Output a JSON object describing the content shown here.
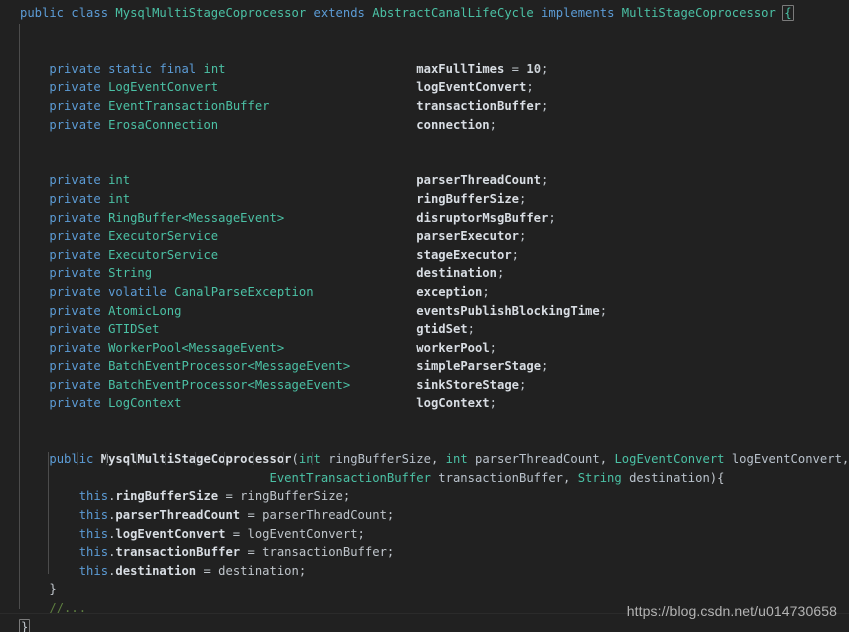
{
  "editor": {
    "language": "java",
    "background_color": "#212121",
    "theme": "dark",
    "colors": {
      "keyword": "#5c9cd6",
      "type": "#4bc1a5",
      "field": "#d8dde3",
      "comment": "#5f8040",
      "plain": "#c0c6cc",
      "indent_guide": "#4c4c4c",
      "brace_highlight_border": "#7b7b7b"
    }
  },
  "watermark": {
    "text": "https://blog.csdn.net/u014730658"
  },
  "code": {
    "class_declaration": {
      "modifier": "public",
      "kw_class": "class",
      "name": "MysqlMultiStageCoprocessor",
      "kw_extends": "extends",
      "superclass": "AbstractCanalLifeCycle",
      "kw_implements": "implements",
      "interface": "MultiStageCoprocessor",
      "open_brace": "{"
    },
    "fields_group_1": [
      {
        "modifiers": "private static final",
        "type": "int",
        "name": "maxFullTimes",
        "initializer": "10"
      },
      {
        "modifiers": "private",
        "type": "LogEventConvert",
        "name": "logEventConvert",
        "initializer": null
      },
      {
        "modifiers": "private",
        "type": "EventTransactionBuffer",
        "name": "transactionBuffer",
        "initializer": null
      },
      {
        "modifiers": "private",
        "type": "ErosaConnection",
        "name": "connection",
        "initializer": null
      }
    ],
    "fields_group_2": [
      {
        "modifiers": "private",
        "type": "int",
        "name": "parserThreadCount",
        "initializer": null
      },
      {
        "modifiers": "private",
        "type": "int",
        "name": "ringBufferSize",
        "initializer": null
      },
      {
        "modifiers": "private",
        "type": "RingBuffer<MessageEvent>",
        "name": "disruptorMsgBuffer",
        "initializer": null
      },
      {
        "modifiers": "private",
        "type": "ExecutorService",
        "name": "parserExecutor",
        "initializer": null
      },
      {
        "modifiers": "private",
        "type": "ExecutorService",
        "name": "stageExecutor",
        "initializer": null
      },
      {
        "modifiers": "private",
        "type": "String",
        "name": "destination",
        "initializer": null
      },
      {
        "modifiers": "private volatile",
        "type": "CanalParseException",
        "name": "exception",
        "initializer": null
      },
      {
        "modifiers": "private",
        "type": "AtomicLong",
        "name": "eventsPublishBlockingTime",
        "initializer": null
      },
      {
        "modifiers": "private",
        "type": "GTIDSet",
        "name": "gtidSet",
        "initializer": null
      },
      {
        "modifiers": "private",
        "type": "WorkerPool<MessageEvent>",
        "name": "workerPool",
        "initializer": null
      },
      {
        "modifiers": "private",
        "type": "BatchEventProcessor<MessageEvent>",
        "name": "simpleParserStage",
        "initializer": null
      },
      {
        "modifiers": "private",
        "type": "BatchEventProcessor<MessageEvent>",
        "name": "sinkStoreStage",
        "initializer": null
      },
      {
        "modifiers": "private",
        "type": "LogContext",
        "name": "logContext",
        "initializer": null
      }
    ],
    "constructor": {
      "modifier": "public",
      "name": "MysqlMultiStageCoprocessor",
      "params_line_1": [
        {
          "type": "int",
          "name": "ringBufferSize"
        },
        {
          "type": "int",
          "name": "parserThreadCount"
        },
        {
          "type": "LogEventConvert",
          "name": "logEventConvert"
        }
      ],
      "params_line_2": [
        {
          "type": "EventTransactionBuffer",
          "name": "transactionBuffer"
        },
        {
          "type": "String",
          "name": "destination"
        }
      ],
      "body": [
        {
          "kw": "this",
          "field": "ringBufferSize",
          "value": "ringBufferSize"
        },
        {
          "kw": "this",
          "field": "parserThreadCount",
          "value": "parserThreadCount"
        },
        {
          "kw": "this",
          "field": "logEventConvert",
          "value": "logEventConvert"
        },
        {
          "kw": "this",
          "field": "transactionBuffer",
          "value": "transactionBuffer"
        },
        {
          "kw": "this",
          "field": "destination",
          "value": "destination"
        }
      ],
      "close_brace": "}"
    },
    "trailing_comment": "//...",
    "class_close_brace": "}"
  }
}
